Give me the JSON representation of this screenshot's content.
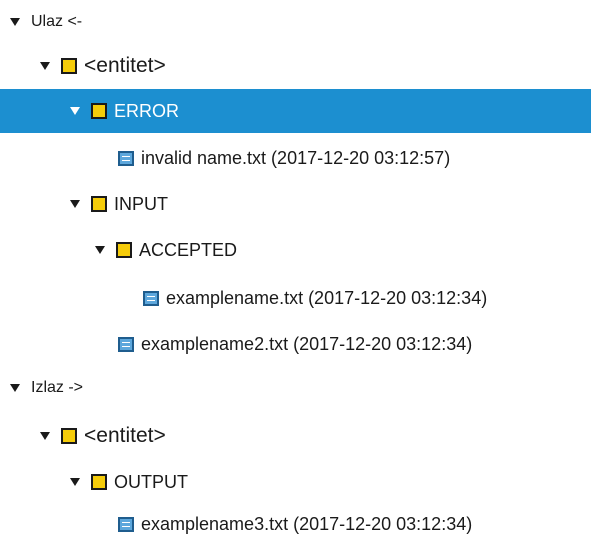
{
  "tree": {
    "ulaz": {
      "label": "Ulaz <-",
      "entitet": {
        "label": "<entitet>",
        "error": {
          "label": "ERROR",
          "files": [
            "invalid name.txt (2017-12-20 03:12:57)"
          ]
        },
        "input": {
          "label": "INPUT",
          "accepted": {
            "label": "ACCEPTED",
            "files": [
              "examplename.txt (2017-12-20 03:12:34)"
            ]
          },
          "files": [
            "examplename2.txt (2017-12-20 03:12:34)"
          ]
        }
      }
    },
    "izlaz": {
      "label": "Izlaz ->",
      "entitet": {
        "label": "<entitet>",
        "output": {
          "label": "OUTPUT",
          "files": [
            "examplename3.txt (2017-12-20 03:12:34)"
          ]
        }
      }
    }
  },
  "colors": {
    "selection": "#1c8fd0",
    "folder": "#f5cc0a",
    "file": "#5da7dc"
  }
}
